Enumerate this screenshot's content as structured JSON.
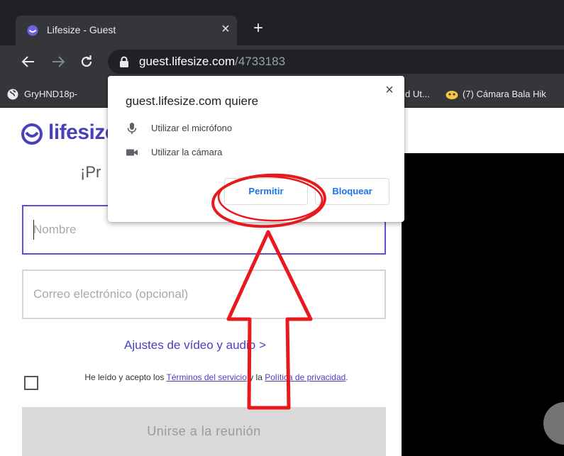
{
  "browser": {
    "tab": {
      "title": "Lifesize - Guest",
      "close": "×"
    },
    "new_tab": "+",
    "url": {
      "host": "guest.lifesize.com",
      "path": "/4733183"
    },
    "bookmarks": [
      {
        "label": "GryHND18p-"
      },
      {
        "label": "d Ut..."
      },
      {
        "label": "(7) Cámara Bala Hik"
      }
    ]
  },
  "page": {
    "logo": "lifesize",
    "greeting": "¡Pr",
    "name_field": {
      "placeholder": "Nombre",
      "value": ""
    },
    "email_field": {
      "placeholder": "Correo electrónico (opcional)",
      "value": ""
    },
    "av_settings_link": "Ajustes de vídeo y audio >",
    "terms": {
      "prefix": "He leído y acepto los ",
      "tos_link": "Términos del servicio",
      "middle": " y la ",
      "privacy_link": "Política de privacidad",
      "suffix": "."
    },
    "join_button": "Unirse a la reunión"
  },
  "permission_dialog": {
    "title": "guest.lifesize.com quiere",
    "close": "×",
    "permissions": [
      {
        "icon": "microphone-icon",
        "label": "Utilizar el micrófono"
      },
      {
        "icon": "camera-icon",
        "label": "Utilizar la cámara"
      }
    ],
    "allow_label": "Permitir",
    "block_label": "Bloquear"
  },
  "colors": {
    "brand": "#4a3fbf",
    "chrome_dark": "#202124",
    "chrome_toolbar": "#35363a",
    "button_text": "#1a73e8",
    "annotation_red": "#e8191c"
  }
}
